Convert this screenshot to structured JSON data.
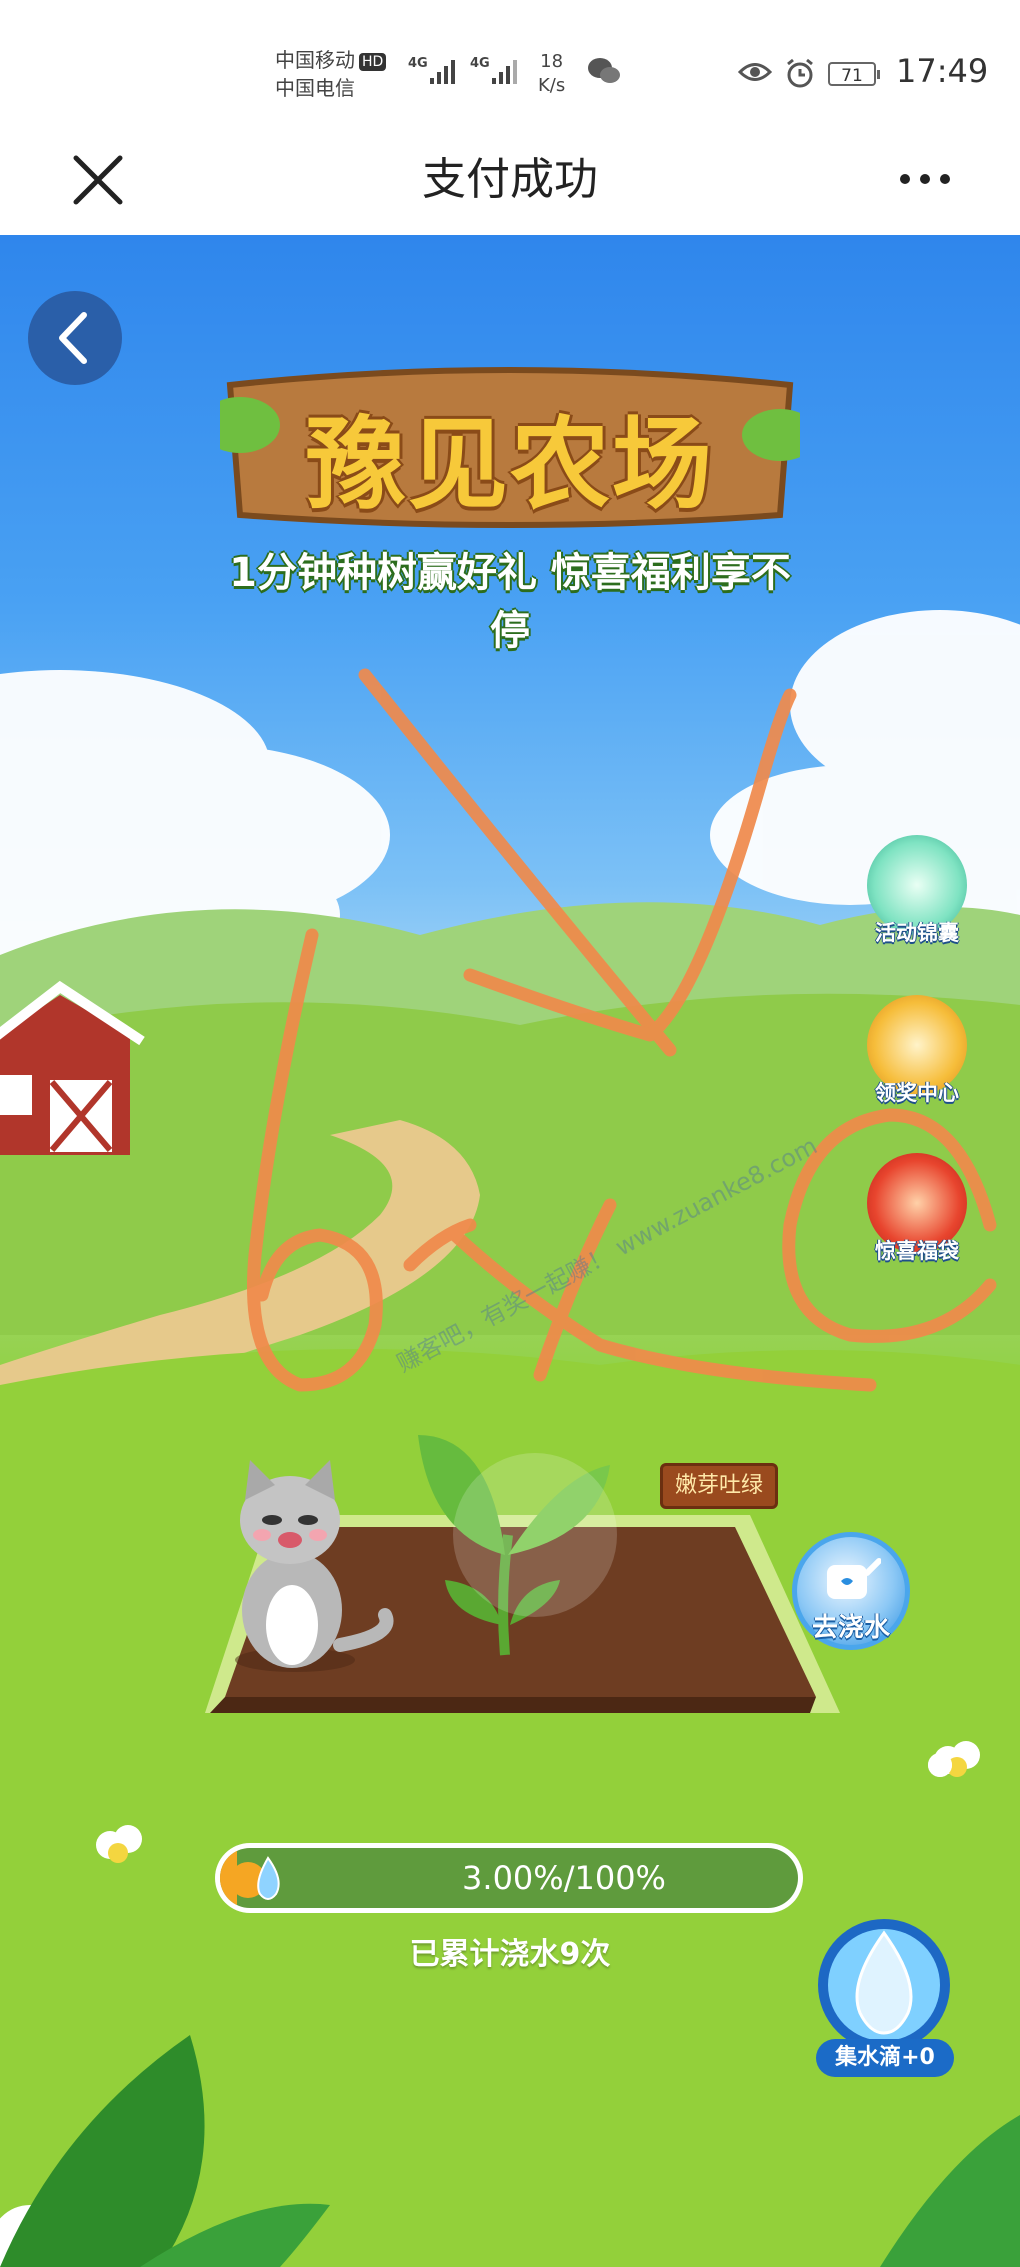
{
  "status_bar": {
    "carrier_1": "中国移动",
    "hd_badge": "HD",
    "carrier_2": "中国电信",
    "network_1": "4G",
    "network_2": "4G",
    "speed_value": "18",
    "speed_unit": "K/s",
    "battery": "71",
    "time": "17:49"
  },
  "nav": {
    "title": "支付成功"
  },
  "game": {
    "logo_title": "豫见农场",
    "logo_subtitle": "1分钟种树赢好礼 惊喜福利享不停",
    "side_buttons": [
      {
        "label": "活动锦囊"
      },
      {
        "label": "领奖中心"
      },
      {
        "label": "惊喜福袋"
      }
    ],
    "sign_text": "嫩芽吐绿",
    "water_button_label": "去浇水",
    "progress": {
      "text": "3.00%/100%",
      "fraction": 0.03
    },
    "water_count_text": "已累计浇水9次",
    "collect_button_label": "集水滴+0",
    "watermark": "赚客吧，有奖一起赚！ www.zuanke8.com"
  },
  "colors": {
    "sky_top": "#2f86ec",
    "grass": "#8ccf3a",
    "soil": "#6e3d22",
    "scribble": "#f08a4b",
    "progress_track": "#5f9b3d",
    "progress_fill": "#f5a623"
  }
}
